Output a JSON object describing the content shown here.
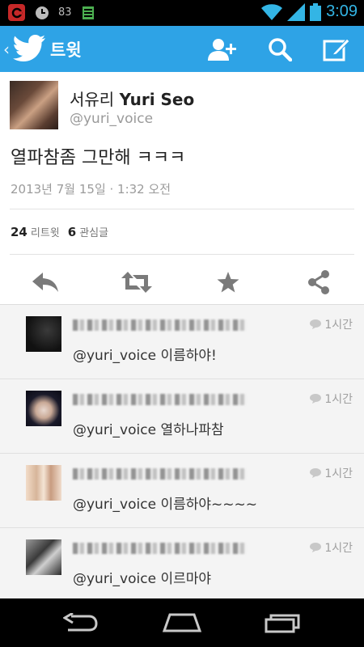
{
  "status_bar": {
    "battery_level": "83",
    "time": "3:09"
  },
  "action_bar": {
    "title": "트윗"
  },
  "tweet": {
    "display_name": "서유리",
    "display_name_en": "Yuri Seo",
    "handle": "@yuri_voice",
    "text": "열파참좀 그만해 ㅋㅋㅋ",
    "date": "2013년 7월 15일 · 1:32 오전",
    "retweet_count": "24",
    "retweet_label": "리트윗",
    "favorite_count": "6",
    "favorite_label": "관심글"
  },
  "replies": [
    {
      "time": "1시간",
      "text": "@yuri_voice 이름하야!"
    },
    {
      "time": "1시간",
      "text": "@yuri_voice 열하나파참"
    },
    {
      "time": "1시간",
      "text": "@yuri_voice 이름하야~~~~"
    },
    {
      "time": "1시간",
      "text": "@yuri_voice 이르마야"
    }
  ],
  "colors": {
    "accent": "#2ea3e6",
    "clock": "#33b5e5"
  }
}
